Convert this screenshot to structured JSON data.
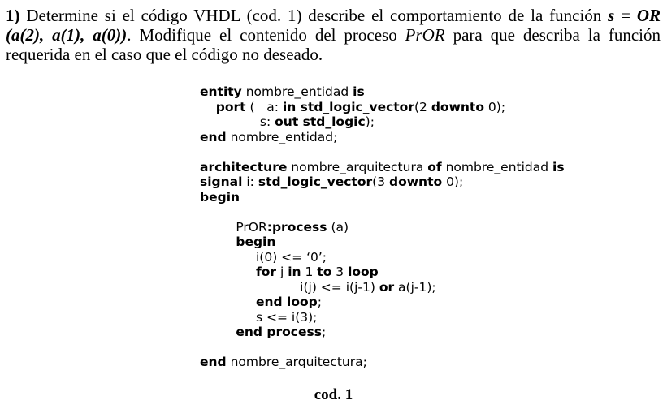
{
  "question": {
    "number": "1)",
    "text_1": " Determine si el código VHDL (cod. 1) describe el comportamiento de la función ",
    "s_bold": "s",
    "text_2": " = ",
    "or_expr": "OR (a(2), a(1), a(0))",
    "text_3": ". Modifique el contenido del proceso ",
    "process_name": "PrOR",
    "text_4": " para que describa la función requerida en el caso que el código no deseado."
  },
  "code_lines": [
    [
      {
        "t": "entity",
        "b": true
      },
      {
        "t": " nombre_entidad "
      },
      {
        "t": "is",
        "b": true
      }
    ],
    [
      {
        "t": "    "
      },
      {
        "t": "port",
        "b": true
      },
      {
        "t": " (   a: "
      },
      {
        "t": "in std_logic_vector",
        "b": true
      },
      {
        "t": "(2 "
      },
      {
        "t": "downto",
        "b": true
      },
      {
        "t": " 0);"
      }
    ],
    [
      {
        "t": "               s: "
      },
      {
        "t": "out std_logic",
        "b": true
      },
      {
        "t": ");"
      }
    ],
    [
      {
        "t": "end",
        "b": true
      },
      {
        "t": " nombre_entidad;"
      }
    ],
    [],
    [
      {
        "t": "architecture",
        "b": true
      },
      {
        "t": " nombre_arquitectura "
      },
      {
        "t": "of",
        "b": true
      },
      {
        "t": " nombre_entidad "
      },
      {
        "t": "is",
        "b": true
      }
    ],
    [
      {
        "t": "signal",
        "b": true
      },
      {
        "t": " i: "
      },
      {
        "t": "std_logic_vector",
        "b": true
      },
      {
        "t": "(3 "
      },
      {
        "t": "downto",
        "b": true
      },
      {
        "t": " 0);"
      }
    ],
    [
      {
        "t": "begin",
        "b": true
      }
    ],
    [],
    [
      {
        "t": "         PrOR"
      },
      {
        "t": ":process",
        "b": true
      },
      {
        "t": " (a)"
      }
    ],
    [
      {
        "t": "         "
      },
      {
        "t": "begin",
        "b": true
      }
    ],
    [
      {
        "t": "              i(0) <= ‘0’;"
      }
    ],
    [
      {
        "t": "              "
      },
      {
        "t": "for",
        "b": true
      },
      {
        "t": " j "
      },
      {
        "t": "in",
        "b": true
      },
      {
        "t": " 1 "
      },
      {
        "t": "to",
        "b": true
      },
      {
        "t": " 3 "
      },
      {
        "t": "loop",
        "b": true
      }
    ],
    [
      {
        "t": "                         i(j) <= i(j-1) "
      },
      {
        "t": "or",
        "b": true
      },
      {
        "t": " a(j-1);"
      }
    ],
    [
      {
        "t": "              "
      },
      {
        "t": "end loop",
        "b": true
      },
      {
        "t": ";"
      }
    ],
    [
      {
        "t": "              s <= i(3);"
      }
    ],
    [
      {
        "t": "         "
      },
      {
        "t": "end process",
        "b": true
      },
      {
        "t": ";"
      }
    ],
    [],
    [
      {
        "t": "end",
        "b": true
      },
      {
        "t": " nombre_arquitectura;"
      }
    ]
  ],
  "caption": "cod. 1"
}
